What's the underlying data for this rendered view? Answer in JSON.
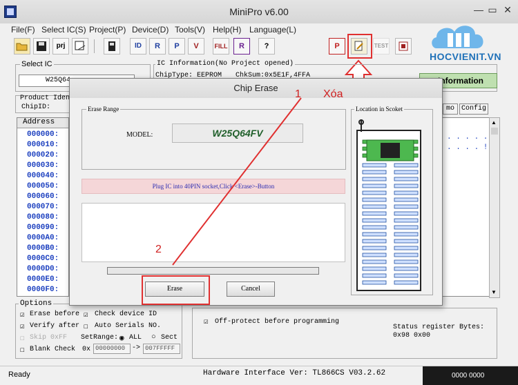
{
  "window": {
    "title": "MiniPro v6.00",
    "controls": [
      "—",
      "▭",
      "✕"
    ]
  },
  "menu": [
    "File(F)",
    "Select IC(S)",
    "Project(P)",
    "Device(D)",
    "Tools(V)",
    "Help(H)",
    "Language(L)"
  ],
  "toolbar": {
    "prj_label": "prj",
    "btn_id": "ID",
    "btn_fill": "FILL",
    "btn_help": "?",
    "btn_p": "P",
    "btn_test": "TEST"
  },
  "logo": {
    "text": "HOCVIENIT.VN"
  },
  "select_ic": {
    "label": "Select IC",
    "value": "W25Q64"
  },
  "ic_info": {
    "label": "IC Information(No Project opened)",
    "chip_type": "ChipType: EEPROM",
    "checksum": "ChkSum:0x5E1F,4FFA"
  },
  "product_id": {
    "label": "Product Iden",
    "chip_id": "ChipID:"
  },
  "information_button": "Information",
  "demo_button": "mo",
  "config_button": "Config",
  "address": {
    "header": "Address",
    "rows": [
      "000000:",
      "000010:",
      "000020:",
      "000030:",
      "000040:",
      "000050:",
      "000060:",
      "000070:",
      "000080:",
      "000090:",
      "0000A0:",
      "0000B0:",
      "0000C0:",
      "0000D0:",
      "0000E0:",
      "0000F0:"
    ]
  },
  "hex_right": {
    "dots": ". . . . .",
    "dots_mark": ". . . . ! ."
  },
  "options": {
    "label": "Options",
    "erase_before": "Erase before",
    "check_device_id": "Check device ID",
    "verify_after": "Verify after",
    "auto_serials": "Auto Serials NO.",
    "skip_0xff": "Skip 0xFF",
    "set_range": "SetRange:",
    "range_all": "ALL",
    "range_sect": "Sect",
    "blank_check": "Blank Check",
    "ox_label": "0x",
    "range_from": "00000000",
    "range_arrow": "->",
    "range_to": "007FFFFF"
  },
  "off_protect": "Off-protect before programming",
  "status_register": {
    "label": "Status register Bytes:",
    "value": "0x98 0x00"
  },
  "status_bar": {
    "left": "Ready",
    "hardware": "Hardware Interface Ver: TL866CS V03.2.62",
    "right": "0000 0000"
  },
  "dialog": {
    "title": "Chip Erase",
    "erase_range": "Erase Range",
    "model_label": "MODEL:",
    "model_value": "W25Q64FV",
    "message": "Plug IC into 40PIN socket,Click <Erase>-Button",
    "location_label": "Location in Scoket",
    "erase_button": "Erase",
    "cancel_button": "Cancel",
    "progress": 0
  },
  "annotations": {
    "one": "1",
    "xoa": "Xóa",
    "two": "2"
  },
  "colors": {
    "accent_red": "#e03030",
    "address_blue": "#1b3fbf",
    "model_green": "#1f5f2a",
    "message_bg": "#f5d6d8"
  }
}
